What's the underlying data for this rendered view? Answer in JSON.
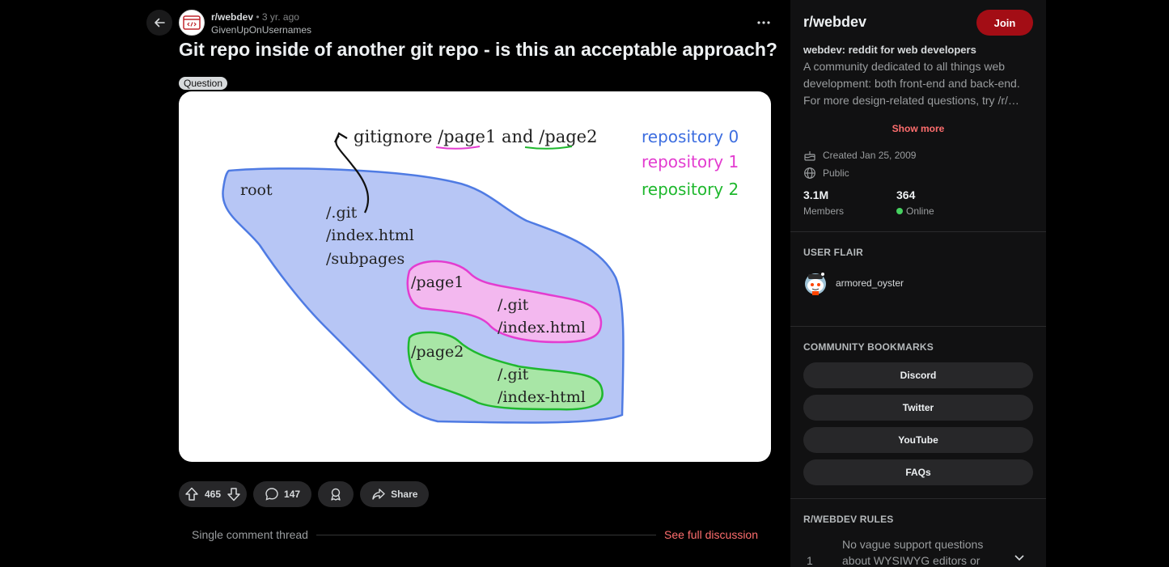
{
  "post": {
    "subreddit": "r/webdev",
    "separator": "•",
    "time": "3 yr. ago",
    "author": "GivenUpOnUsernames",
    "title": "Git repo inside of another git repo - is this an acceptable approach?",
    "flair": "Question",
    "image": {
      "top_text": "gitignore /page1 and /page2",
      "legend": [
        "repository 0",
        "repository 1",
        "repository 2"
      ],
      "legend_colors": [
        "#3d6ee0",
        "#e33cd0",
        "#1fb82e"
      ],
      "root_label": "root",
      "root_items": [
        "/.git",
        "/index.html",
        "/subpages"
      ],
      "page1_label": "/page1",
      "page1_items": [
        "/.git",
        "/index.html"
      ],
      "page2_label": "/page2",
      "page2_items": [
        "/.git",
        "/index-html"
      ]
    }
  },
  "actions": {
    "upvotes": "465",
    "comments": "147",
    "share": "Share"
  },
  "thread": {
    "label": "Single comment thread",
    "link": "See full discussion"
  },
  "sidebar": {
    "name": "r/webdev",
    "join": "Join",
    "tagline": "webdev: reddit for web developers",
    "description": "A community dedicated to all things web development: both front-end and back-end. For more design-related questions, try /r/…",
    "show_more": "Show more",
    "created": "Created Jan 25, 2009",
    "visibility": "Public",
    "members_count": "3.1M",
    "members_label": "Members",
    "online_count": "364",
    "online_label": "Online",
    "user_flair_heading": "USER FLAIR",
    "flair_user": "armored_oyster",
    "bookmarks_heading": "COMMUNITY BOOKMARKS",
    "bookmarks": [
      "Discord",
      "Twitter",
      "YouTube",
      "FAQs"
    ],
    "rules_heading": "R/WEBDEV RULES",
    "rule_number": "1",
    "rule_text": "No vague support questions about WYSIWYG editors or"
  },
  "colors": {
    "background": "#000000",
    "sidebar": "#111112",
    "accent": "#ff6e6e",
    "join": "#a30d15"
  }
}
